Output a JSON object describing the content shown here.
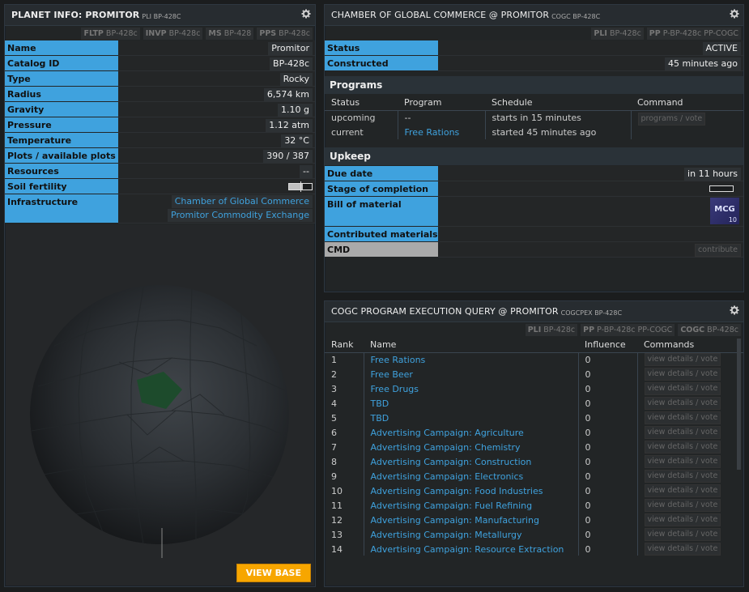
{
  "planet_panel": {
    "title": "PLANET INFO: PROMITOR",
    "subtitle": "PLI BP-428C",
    "tags": [
      {
        "code": "FLTP",
        "arg": "BP-428c"
      },
      {
        "code": "INVP",
        "arg": "BP-428c"
      },
      {
        "code": "MS",
        "arg": "BP-428"
      },
      {
        "code": "PPS",
        "arg": "BP-428c"
      }
    ],
    "rows": [
      {
        "label": "Name",
        "value": "Promitor"
      },
      {
        "label": "Catalog ID",
        "value": "BP-428c"
      },
      {
        "label": "Type",
        "value": "Rocky"
      },
      {
        "label": "Radius",
        "value": "6,574 km"
      },
      {
        "label": "Gravity",
        "value": "1.10 g"
      },
      {
        "label": "Pressure",
        "value": "1.12 atm"
      },
      {
        "label": "Temperature",
        "value": "32 °C"
      },
      {
        "label": "Plots / available plots",
        "value": "390 / 387"
      },
      {
        "label": "Resources",
        "value": "--"
      },
      {
        "label": "Soil fertility",
        "value": ""
      }
    ],
    "soil_fertility_level": 0.6,
    "infrastructure_label": "Infrastructure",
    "infrastructure": [
      "Chamber of Global Commerce",
      "Promitor Commodity Exchange"
    ],
    "view_base_label": "VIEW BASE"
  },
  "cogc_panel": {
    "title": "CHAMBER OF GLOBAL COMMERCE @ PROMITOR",
    "subtitle": "COGC BP-428C",
    "tags": [
      {
        "code": "PLI",
        "arg": "BP-428c"
      },
      {
        "code": "PP",
        "arg": "P-BP-428c PP-COGC"
      }
    ],
    "status_label": "Status",
    "status_value": "ACTIVE",
    "constructed_label": "Constructed",
    "constructed_value": "45 minutes ago",
    "programs_heading": "Programs",
    "programs_headers": [
      "Status",
      "Program",
      "Schedule",
      "Command"
    ],
    "programs": [
      {
        "status": "upcoming",
        "program": "--",
        "schedule": "starts in 15 minutes"
      },
      {
        "status": "current",
        "program": "Free Rations",
        "schedule": "started 45 minutes ago"
      }
    ],
    "programs_command": "programs / vote",
    "upkeep_heading": "Upkeep",
    "due_label": "Due date",
    "due_value": "in 11 hours",
    "stage_label": "Stage of completion",
    "stage_progress": 0,
    "bom_label": "Bill of material",
    "bom_material": {
      "ticker": "MCG",
      "amount": "10"
    },
    "contributed_label": "Contributed materials",
    "cmd_label": "CMD",
    "contribute_label": "contribute"
  },
  "query_panel": {
    "title": "COGC PROGRAM EXECUTION QUERY @ PROMITOR",
    "subtitle": "COGCPEX BP-428C",
    "tags": [
      {
        "code": "PLI",
        "arg": "BP-428c"
      },
      {
        "code": "PP",
        "arg": "P-BP-428c PP-COGC"
      },
      {
        "code": "COGC",
        "arg": "BP-428c"
      }
    ],
    "headers": [
      "Rank",
      "Name",
      "Influence",
      "Commands"
    ],
    "command_label": "view details / vote",
    "rows": [
      {
        "rank": "1",
        "name": "Free Rations",
        "influence": "0"
      },
      {
        "rank": "2",
        "name": "Free Beer",
        "influence": "0"
      },
      {
        "rank": "3",
        "name": "Free Drugs",
        "influence": "0"
      },
      {
        "rank": "4",
        "name": "TBD",
        "influence": "0"
      },
      {
        "rank": "5",
        "name": "TBD",
        "influence": "0"
      },
      {
        "rank": "6",
        "name": "Advertising Campaign: Agriculture",
        "influence": "0"
      },
      {
        "rank": "7",
        "name": "Advertising Campaign: Chemistry",
        "influence": "0"
      },
      {
        "rank": "8",
        "name": "Advertising Campaign: Construction",
        "influence": "0"
      },
      {
        "rank": "9",
        "name": "Advertising Campaign: Electronics",
        "influence": "0"
      },
      {
        "rank": "10",
        "name": "Advertising Campaign: Food Industries",
        "influence": "0"
      },
      {
        "rank": "11",
        "name": "Advertising Campaign: Fuel Refining",
        "influence": "0"
      },
      {
        "rank": "12",
        "name": "Advertising Campaign: Manufacturing",
        "influence": "0"
      },
      {
        "rank": "13",
        "name": "Advertising Campaign: Metallurgy",
        "influence": "0"
      },
      {
        "rank": "14",
        "name": "Advertising Campaign: Resource Extraction",
        "influence": "0"
      }
    ]
  }
}
